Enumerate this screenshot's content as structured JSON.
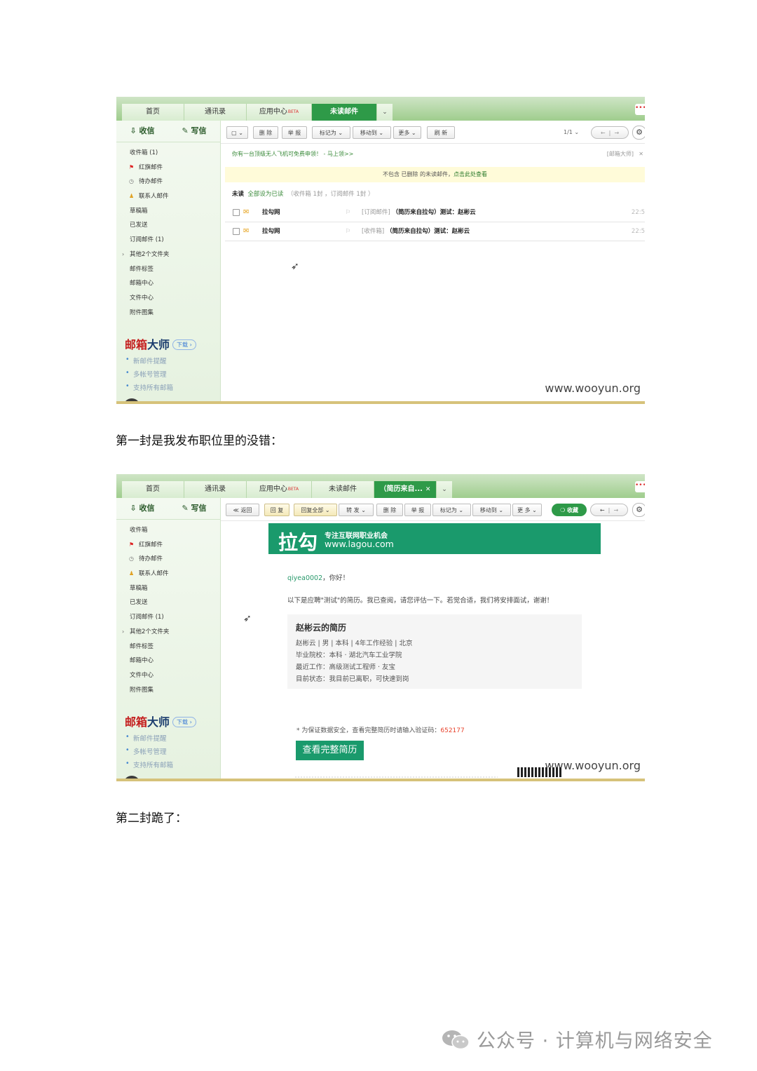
{
  "shot1": {
    "tabs": [
      "首页",
      "通讯录",
      "应用中心",
      "未读邮件"
    ],
    "beta": "BETA",
    "more_dots": "•••",
    "compose": {
      "receive": "收信",
      "write": "写信"
    },
    "folders": [
      {
        "label": "收件箱 (1)",
        "icon": ""
      },
      {
        "label": "红旗邮件",
        "icon": "flag-icon"
      },
      {
        "label": "待办邮件",
        "icon": "clock-icon"
      },
      {
        "label": "联系人邮件",
        "icon": "contact-icon"
      },
      {
        "label": "草稿箱",
        "icon": ""
      },
      {
        "label": "已发送",
        "icon": ""
      },
      {
        "label": "订阅邮件 (1)",
        "icon": ""
      },
      {
        "label": "其他2个文件夹",
        "icon": "chevron-right-icon"
      },
      {
        "label": "邮件标签",
        "icon": ""
      },
      {
        "label": "邮箱中心",
        "icon": ""
      },
      {
        "label": "文件中心",
        "icon": ""
      },
      {
        "label": "附件图集",
        "icon": ""
      }
    ],
    "toolbar": {
      "select": "▢ ⌄",
      "delete": "删 除",
      "report": "举 报",
      "mark_as": "标记为 ⌄",
      "move_to": "移动到 ⌄",
      "more": "更多 ⌄",
      "refresh": "刷 新",
      "pager": "1/1 ⌄"
    },
    "notice": {
      "text": "你有一台顶级无人飞机可免费申领！ - 马上领>>",
      "tag": "[邮箱大师]",
      "close": "✕"
    },
    "yellow": {
      "text": "不包含 已删除 的未读邮件，",
      "link": "点击此处查看"
    },
    "unread_head": {
      "title": "未读",
      "mark_all": "全部设为已读",
      "counts": "（收件箱 1封 ，订阅邮件 1封 ）"
    },
    "rows": [
      {
        "sender": "拉勾网",
        "folder": "[订阅邮件]",
        "subject": "（简历来自拉勾）测试：赵彬云",
        "time": "22:5"
      },
      {
        "sender": "拉勾网",
        "folder": "[收件箱]",
        "subject": "（简历来自拉勾）测试：赵彬云",
        "time": "22:5"
      }
    ],
    "promo": {
      "title_red": "邮箱",
      "title_blue": "大师",
      "download": "下载 ›",
      "items": [
        "新邮件提醒",
        "多帐号管理",
        "支持所有邮箱"
      ]
    },
    "watermark": "www.wooyun.org"
  },
  "caption1": "第一封是我发布职位里的没错：",
  "shot2": {
    "tabs": [
      "首页",
      "通讯录",
      "应用中心",
      "未读邮件",
      "（简历来自..."
    ],
    "toolbar": {
      "back": "≪ 返回",
      "reply": "回 复",
      "reply_all": "回复全部",
      "forward": "转 发",
      "delete": "删 除",
      "report": "举 报",
      "mark_as": "标记为 ⌄",
      "move_to": "移动到 ⌄",
      "more": "更 多 ⌄",
      "collect": "收藏"
    },
    "folders": [
      "收件箱",
      "红旗邮件",
      "待办邮件",
      "联系人邮件",
      "草稿箱",
      "已发送",
      "订阅邮件 (1)",
      "其他2个文件夹",
      "邮件标签",
      "邮箱中心",
      "文件中心",
      "附件图集"
    ],
    "banner": {
      "logo": "拉勾",
      "slogan": "专注互联网职业机会",
      "url": "www.lagou.com"
    },
    "greeting_user": "qiyea0002",
    "greeting_rest": "，你好！",
    "intro": "以下是应聘\"测试\"的简历。我已查阅，请您评估一下。若觉合适，我们将安排面试，谢谢！",
    "resume": {
      "title": "赵彬云的简历",
      "lines": [
        "赵彬云 | 男 | 本科 | 4年工作经验 | 北京",
        "毕业院校：本科 · 湖北汽车工业学院",
        "最近工作：高级测试工程师 · 友宝",
        "目前状态：我目前已离职，可快速到岗"
      ]
    },
    "verify_prefix": "* 为保证数据安全，查看完整简历时请输入验证码：",
    "verify_code": "652177",
    "view_button": "查看完整简历",
    "watermark": "www.wooyun.org"
  },
  "caption2": "第二封跪了：",
  "wechat": "公众号 · 计算机与网络安全"
}
